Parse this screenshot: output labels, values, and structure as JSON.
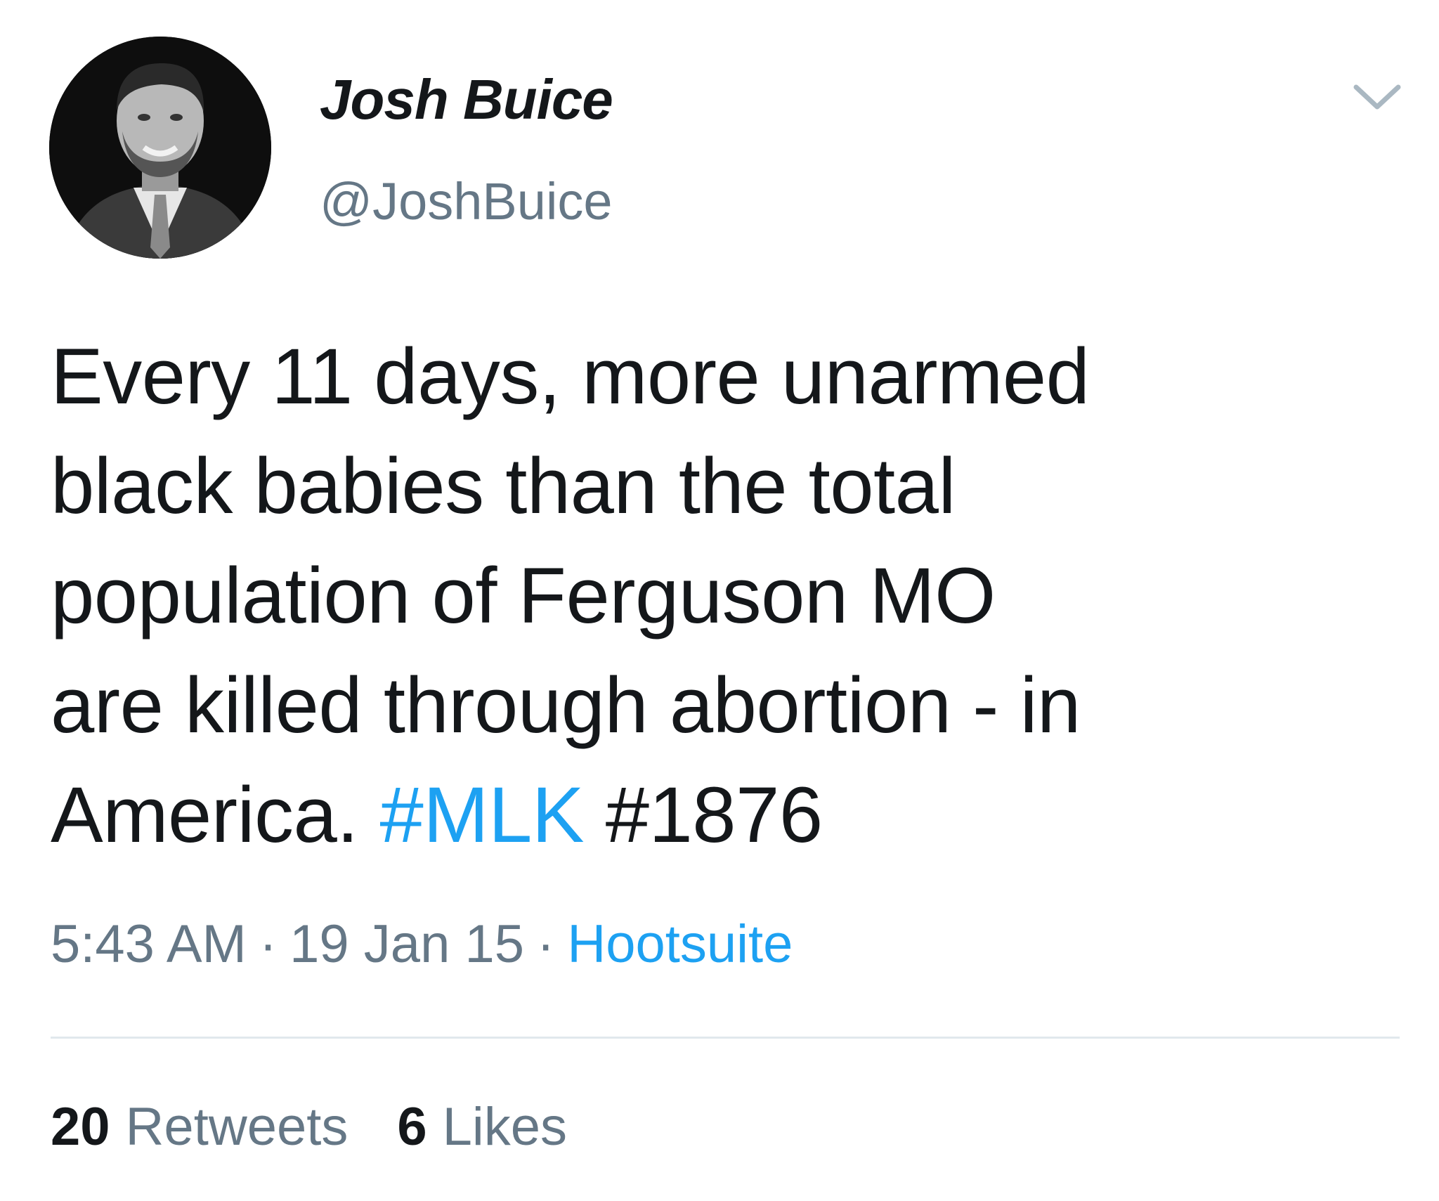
{
  "user": {
    "display_name": "Josh Buice",
    "handle": "@JoshBuice",
    "avatar_icon": "profile-photo"
  },
  "tweet": {
    "lines": [
      "Every 11 days, more unarmed",
      "black babies than the total",
      "population of Ferguson MO",
      "are killed through abortion - in"
    ],
    "last_line_prefix": "America.",
    "hashtags": [
      "#MLK",
      "#1876"
    ]
  },
  "meta": {
    "time": "5:43 AM",
    "separator": "·",
    "date": "19 Jan 15",
    "source": "Hootsuite"
  },
  "stats": {
    "retweets_count": "20",
    "retweets_label": "Retweets",
    "likes_count": "6",
    "likes_label": "Likes"
  },
  "colors": {
    "link": "#1da1f2",
    "secondary_text": "#657786",
    "primary_text": "#14171a",
    "divider": "#e1e8ed"
  },
  "icons": {
    "more_menu": "chevron-down-icon"
  }
}
